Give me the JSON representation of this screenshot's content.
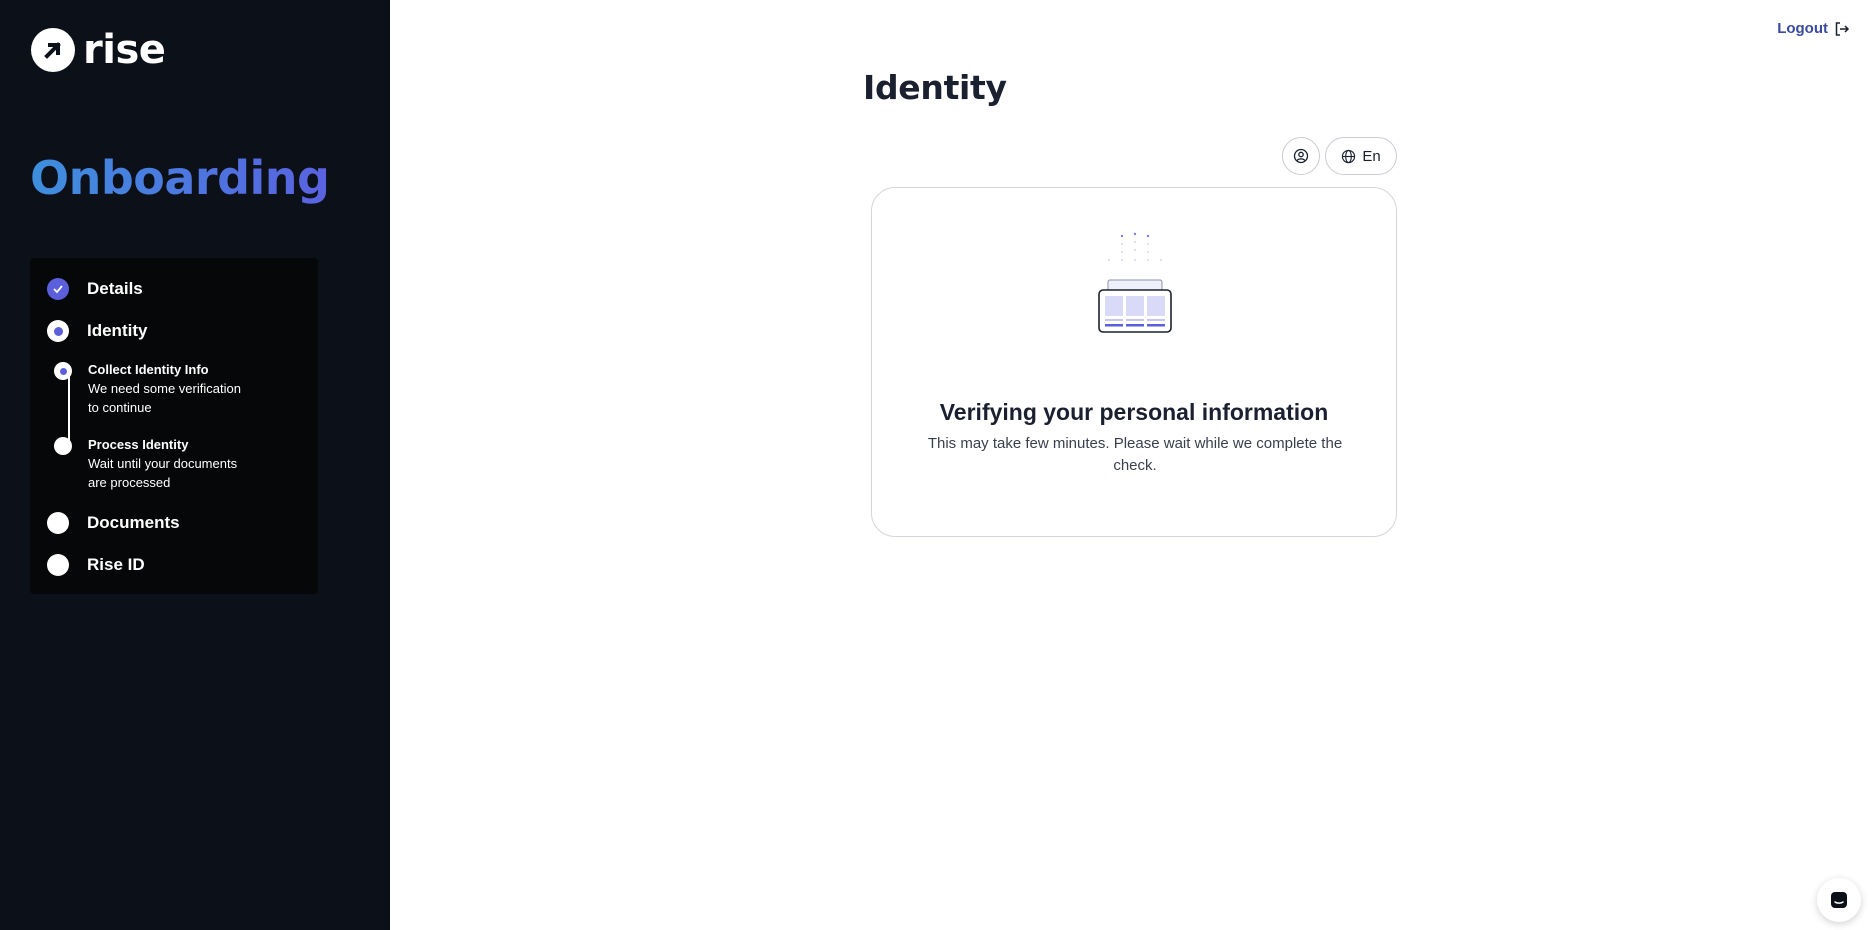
{
  "brand": {
    "name": "rise"
  },
  "sidebar": {
    "title": "Onboarding",
    "steps": [
      {
        "label": "Details",
        "state": "done"
      },
      {
        "label": "Identity",
        "state": "active"
      },
      {
        "label": "Documents",
        "state": "pending"
      },
      {
        "label": "Rise ID",
        "state": "pending"
      }
    ],
    "substeps": [
      {
        "title": "Collect Identity Info",
        "desc_line1": "We need some verification",
        "desc_line2": "to continue",
        "state": "active"
      },
      {
        "title": "Process Identity",
        "desc_line1": "Wait until your documents",
        "desc_line2": "are processed",
        "state": "pending"
      }
    ]
  },
  "header": {
    "logout_label": "Logout"
  },
  "main": {
    "title": "Identity",
    "language": "En",
    "card": {
      "title": "Verifying your personal information",
      "desc_line1": "This may take few minutes. Please wait while we complete the",
      "desc_line2": "check."
    }
  },
  "colors": {
    "accent": "#5b5fdc",
    "sidebar_bg": "#0c1018",
    "logout_text": "#3a4ba0"
  }
}
